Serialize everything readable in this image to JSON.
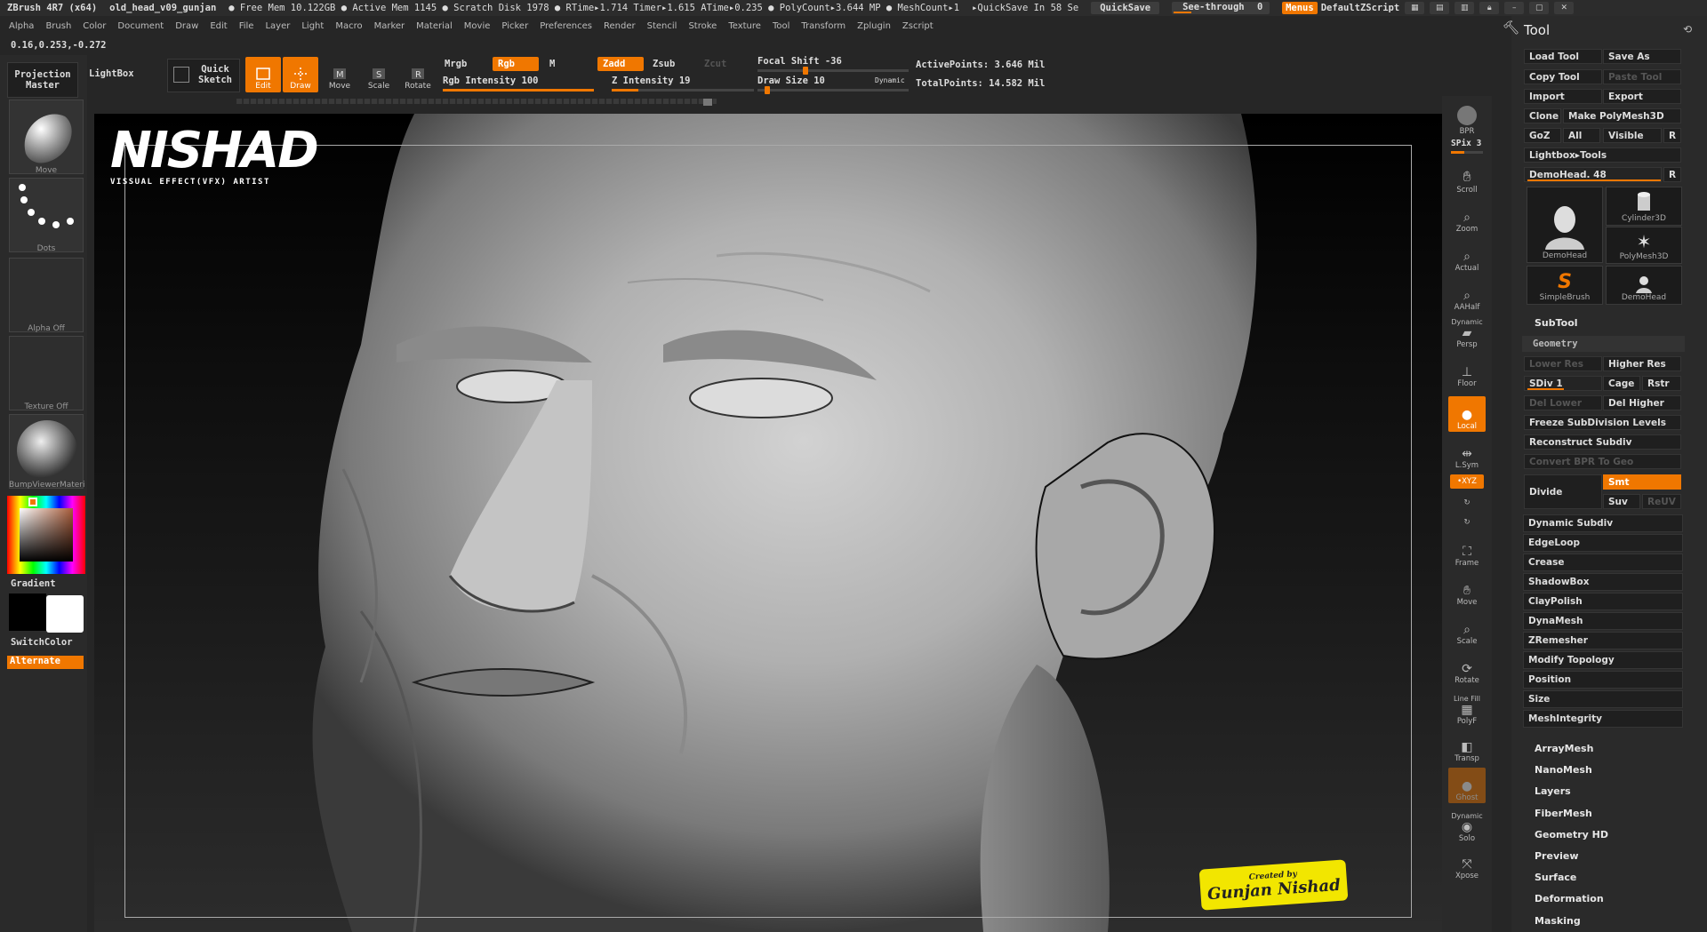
{
  "titlebar": {
    "app": "ZBrush 4R7 (x64)",
    "document": "old_head_v09_gunjan",
    "stats": "● Free Mem 10.122GB ● Active Mem 1145 ● Scratch Disk 1978 ● RTime▸1.714 Timer▸1.615 ATime▸0.235 ● PolyCount▸3.644 MP ● MeshCount▸1",
    "quicksave_timer": "▸QuickSave In 58 Se",
    "quicksave_label": "QuickSave",
    "seethrough_label": "See-through",
    "seethrough_value": "0",
    "seethrough_level": 0,
    "menus_label": "Menus",
    "script_label": "DefaultZScript"
  },
  "menubar": [
    "Alpha",
    "Brush",
    "Color",
    "Document",
    "Draw",
    "Edit",
    "File",
    "Layer",
    "Light",
    "Macro",
    "Marker",
    "Material",
    "Movie",
    "Picker",
    "Preferences",
    "Render",
    "Stencil",
    "Stroke",
    "Texture",
    "Tool",
    "Transform",
    "Zplugin",
    "Zscript"
  ],
  "coords": "0.16,0.253,-0.272",
  "left": {
    "projection_master": "Projection Master",
    "lightbox": "LightBox",
    "quick_sketch": "Quick Sketch",
    "thumb_labels": [
      "Move",
      "Dots",
      "Alpha Off",
      "Texture Off",
      "BumpViewerMateri"
    ],
    "gradient": "Gradient",
    "switchcolor": "SwitchColor",
    "alternate": "Alternate"
  },
  "toolbar": {
    "edit": "Edit",
    "draw": "Draw",
    "move": "Move",
    "scale": "Scale",
    "rotate": "Rotate",
    "mrgb": "Mrgb",
    "rgb": "Rgb",
    "m": "M",
    "zadd": "Zadd",
    "zsub": "Zsub",
    "zcut": "Zcut",
    "rgb_intensity": "Rgb Intensity 100",
    "rgb_intensity_value": 100,
    "z_intensity": "Z Intensity 19",
    "z_intensity_value": 19,
    "focal_shift": "Focal Shift -36",
    "focal_shift_value": -36,
    "draw_size": "Draw Size 10",
    "draw_size_value": 10,
    "dynamic": "Dynamic",
    "active_points": "ActivePoints: 3.646 Mil",
    "total_points": "TotalPoints: 14.582 Mil"
  },
  "viewport": {
    "logo_text": "NISHAD",
    "logo_sub": "VISSUAL EFFECT(VFX) ARTIST",
    "credit_top": "Created by",
    "credit_name": "Gunjan Nishad"
  },
  "rightdock": {
    "bpr": "BPR",
    "spix": "SPix 3",
    "spix_value": 3,
    "scroll": "Scroll",
    "zoom": "Zoom",
    "actual": "Actual",
    "aahalf": "AAHalf",
    "dynamic": "Dynamic",
    "persp": "Persp",
    "floor": "Floor",
    "local": "Local",
    "lsym": "L.Sym",
    "xyz": "•XYZ",
    "frame": "Frame",
    "move": "Move",
    "scale": "Scale",
    "rotate": "Rotate",
    "line_fill": "Line Fill",
    "polyf": "PolyF",
    "transp": "Transp",
    "ghost": "Ghost",
    "dynamic2": "Dynamic",
    "solo": "Solo",
    "xpose": "Xpose"
  },
  "tool": {
    "title": "Tool",
    "load_tool": "Load Tool",
    "save_as": "Save As",
    "copy_tool": "Copy Tool",
    "paste_tool": "Paste Tool",
    "import": "Import",
    "export": "Export",
    "clone": "Clone",
    "make_polymesh": "Make PolyMesh3D",
    "goz": "GoZ",
    "all": "All",
    "visible": "Visible",
    "r": "R",
    "lightbox_tools": "Lightbox▸Tools",
    "demohead_slider": "DemoHead. 48",
    "demohead_value": 48,
    "thumbs": [
      "DemoHead",
      "Cylinder3D",
      "PolyMesh3D",
      "SimpleBrush",
      "DemoHead"
    ],
    "subtool": "SubTool",
    "geometry": "Geometry",
    "lower_res": "Lower Res",
    "higher_res": "Higher Res",
    "sdiv": "SDiv 1",
    "sdiv_value": 1,
    "cage": "Cage",
    "rstr": "Rstr",
    "del_lower": "Del Lower",
    "del_higher": "Del Higher",
    "freeze": "Freeze SubDivision Levels",
    "reconstruct": "Reconstruct Subdiv",
    "convert_bpr": "Convert BPR To Geo",
    "divide": "Divide",
    "smt": "Smt",
    "suv": "Suv",
    "reuv": "ReUV",
    "geometry_items": [
      "Dynamic Subdiv",
      "EdgeLoop",
      "Crease",
      "ShadowBox",
      "ClayPolish",
      "DynaMesh",
      "ZRemesher",
      "Modify Topology",
      "Position",
      "Size",
      "MeshIntegrity"
    ],
    "sections": [
      "ArrayMesh",
      "NanoMesh",
      "Layers",
      "FiberMesh",
      "Geometry HD",
      "Preview",
      "Surface",
      "Deformation",
      "Masking"
    ]
  }
}
